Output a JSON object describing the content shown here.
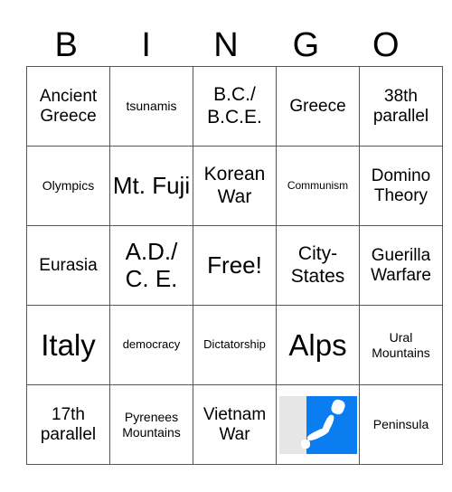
{
  "header": [
    "B",
    "I",
    "N",
    "G",
    "O"
  ],
  "cells": [
    [
      "Ancient Greece",
      "tsunamis",
      "B.C./ B.C.E.",
      "Greece",
      "38th parallel"
    ],
    [
      "Olympics",
      "Mt. Fuji",
      "Korean War",
      "Communism",
      "Domino Theory"
    ],
    [
      "Eurasia",
      "A.D./ C. E.",
      "Free!",
      "City-States",
      "Guerilla Warfare"
    ],
    [
      "Italy",
      "democracy",
      "Dictatorship",
      "Alps",
      "Ural Mountains"
    ],
    [
      "17th parallel",
      "Pyrenees Mountains",
      "Vietnam War",
      "[map-of-japan-image]",
      "Peninsula"
    ]
  ],
  "map_image": "map-of-japan-and-korea",
  "colors": {
    "map_water": "#0a7df0",
    "grid": "#555555"
  }
}
